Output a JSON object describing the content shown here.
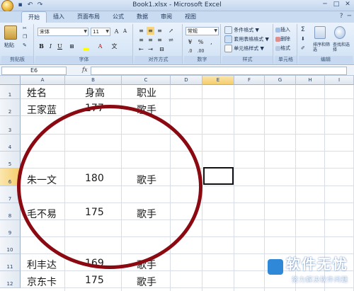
{
  "window": {
    "title": "Book1.xlsx - Microsoft Excel",
    "quick_access": [
      "save-icon",
      "undo-icon",
      "redo-icon"
    ],
    "controls": {
      "minimize": "─",
      "restore": "□",
      "close": "✕"
    }
  },
  "ribbon_tabs": [
    "开始",
    "插入",
    "页面布局",
    "公式",
    "数据",
    "审阅",
    "视图"
  ],
  "ribbon": {
    "clipboard": {
      "label": "剪贴板",
      "paste": "粘贴"
    },
    "font": {
      "label": "字体",
      "font_name": "宋体",
      "font_size": "11",
      "bold": "B",
      "italic": "I",
      "underline": "U"
    },
    "alignment": {
      "label": "对齐方式"
    },
    "number": {
      "label": "数字",
      "format": "常规",
      "percent": "%",
      "comma": ","
    },
    "styles": {
      "label": "样式",
      "conditional": "条件格式",
      "table": "套用表格格式",
      "cell": "单元格样式"
    },
    "cells": {
      "label": "单元格",
      "insert": "插入",
      "delete": "删除",
      "format": "格式"
    },
    "editing": {
      "label": "编辑",
      "sum": "Σ",
      "sort": "排序和筛选",
      "find": "查找和选择"
    }
  },
  "formula_bar": {
    "name_box": "E6",
    "fx": "fx",
    "value": ""
  },
  "columns": [
    "A",
    "B",
    "C",
    "D",
    "E",
    "F",
    "G",
    "H",
    "I"
  ],
  "rows": [
    "1",
    "2",
    "3",
    "4",
    "5",
    "6",
    "7",
    "8",
    "9",
    "10",
    "11",
    "12"
  ],
  "cells": {
    "A1": "姓名",
    "B1": "身高",
    "C1": "职业",
    "A2": "王家蓝",
    "B2": "177",
    "C2": "歌手",
    "A6": "朱一文",
    "B6": "180",
    "C6": "歌手",
    "A8": "毛不易",
    "B8": "175",
    "C8": "歌手",
    "A11": "利丰达",
    "B11": "169",
    "C11": "歌手",
    "A12": "京东卡",
    "B12": "175",
    "C12": "歌手"
  },
  "annotation": {
    "shape": "circle",
    "color": "#8b0a12"
  },
  "watermark": {
    "title": "软件无忧",
    "subtitle": "努力解决软件问题"
  },
  "colors": {
    "selection_header": "#f5cd6c",
    "tab_bar": "#c9dbf1"
  }
}
